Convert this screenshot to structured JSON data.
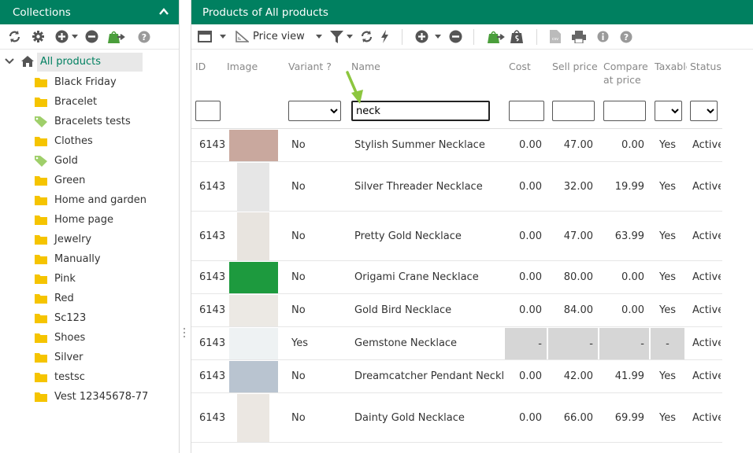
{
  "left": {
    "title": "Collections",
    "tree_root": "All products",
    "items": [
      {
        "label": "Black Friday",
        "icon": "folder-icon"
      },
      {
        "label": "Bracelet",
        "icon": "folder-icon"
      },
      {
        "label": "Bracelets tests",
        "icon": "tag-icon"
      },
      {
        "label": "Clothes",
        "icon": "folder-icon"
      },
      {
        "label": "Gold",
        "icon": "tag-icon"
      },
      {
        "label": "Green",
        "icon": "folder-icon"
      },
      {
        "label": "Home and garden",
        "icon": "folder-icon"
      },
      {
        "label": "Home page",
        "icon": "folder-icon"
      },
      {
        "label": "Jewelry",
        "icon": "folder-icon"
      },
      {
        "label": "Manually",
        "icon": "folder-icon"
      },
      {
        "label": "Pink",
        "icon": "folder-icon"
      },
      {
        "label": "Red",
        "icon": "folder-icon"
      },
      {
        "label": "Sc123",
        "icon": "folder-icon"
      },
      {
        "label": "Shoes",
        "icon": "folder-icon"
      },
      {
        "label": "Silver",
        "icon": "folder-icon"
      },
      {
        "label": "testsc",
        "icon": "folder-icon"
      },
      {
        "label": "Vest 12345678-77",
        "icon": "folder-icon"
      }
    ]
  },
  "right": {
    "title": "Products of All products",
    "view_label": "Price view"
  },
  "grid": {
    "columns": {
      "id": "ID",
      "image": "Image",
      "variant": "Variant ?",
      "name": "Name",
      "cost": "Cost",
      "sell": "Sell price",
      "compare": "Compare at price",
      "taxable": "Taxable",
      "status": "Status"
    },
    "filters": {
      "name": "neck"
    },
    "rows": [
      {
        "id": "6143",
        "variant": "No",
        "name": "Stylish Summer Necklace",
        "cost": "0.00",
        "sell": "47.00",
        "compare": "0.00",
        "taxable": "Yes",
        "status": "Active",
        "thumb": "#c9a89e"
      },
      {
        "id": "6143",
        "variant": "No",
        "name": "Silver Threader Necklace",
        "cost": "0.00",
        "sell": "32.00",
        "compare": "19.99",
        "taxable": "Yes",
        "status": "Active",
        "thumb": "#e6e6e6"
      },
      {
        "id": "6143",
        "variant": "No",
        "name": "Pretty Gold Necklace",
        "cost": "0.00",
        "sell": "47.00",
        "compare": "63.99",
        "taxable": "Yes",
        "status": "Active",
        "thumb": "#e8e4df"
      },
      {
        "id": "6143",
        "variant": "No",
        "name": "Origami Crane Necklace",
        "cost": "0.00",
        "sell": "80.00",
        "compare": "0.00",
        "taxable": "Yes",
        "status": "Active",
        "thumb": "#1d9a3e"
      },
      {
        "id": "6143",
        "variant": "No",
        "name": "Gold Bird Necklace",
        "cost": "0.00",
        "sell": "84.00",
        "compare": "0.00",
        "taxable": "Yes",
        "status": "Active",
        "thumb": "#ece9e4"
      },
      {
        "id": "6143",
        "variant": "Yes",
        "name": "Gemstone Necklace",
        "cost": "-",
        "sell": "-",
        "compare": "-",
        "taxable": "-",
        "status": "Active",
        "thumb": "#eef2f3",
        "grey": true
      },
      {
        "id": "6143",
        "variant": "No",
        "name": "Dreamcatcher Pendant Necklace",
        "cost": "0.00",
        "sell": "42.00",
        "compare": "41.99",
        "taxable": "Yes",
        "status": "Active",
        "thumb": "#b9c4d0"
      },
      {
        "id": "6143",
        "variant": "No",
        "name": "Dainty Gold Necklace",
        "cost": "0.00",
        "sell": "66.00",
        "compare": "69.99",
        "taxable": "Yes",
        "status": "Active",
        "thumb": "#ebe7e2"
      }
    ]
  },
  "colors": {
    "brand": "#008060",
    "icon": "#555555",
    "accent_arrow": "#8cc63f",
    "folder": "#f5c400",
    "tag": "#9fcf6a"
  }
}
